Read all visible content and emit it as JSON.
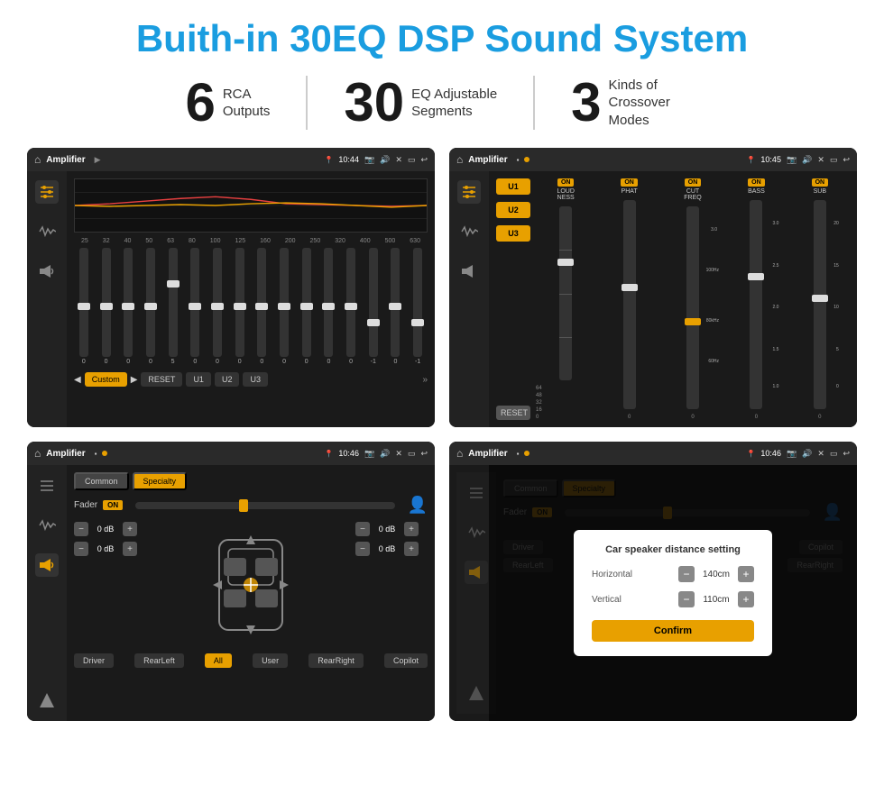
{
  "title": "Buith-in 30EQ DSP Sound System",
  "stats": [
    {
      "number": "6",
      "desc": "RCA\nOutputs"
    },
    {
      "number": "30",
      "desc": "EQ Adjustable\nSegments"
    },
    {
      "number": "3",
      "desc": "Kinds of\nCrossover Modes"
    }
  ],
  "screens": [
    {
      "id": "screen1",
      "statusBar": {
        "title": "Amplifier",
        "time": "10:44"
      },
      "type": "eq"
    },
    {
      "id": "screen2",
      "statusBar": {
        "title": "Amplifier",
        "time": "10:45"
      },
      "type": "crossover"
    },
    {
      "id": "screen3",
      "statusBar": {
        "title": "Amplifier",
        "time": "10:46"
      },
      "type": "fader"
    },
    {
      "id": "screen4",
      "statusBar": {
        "title": "Amplifier",
        "time": "10:46"
      },
      "type": "fader-dialog"
    }
  ],
  "eq": {
    "frequencies": [
      "25",
      "32",
      "40",
      "50",
      "63",
      "80",
      "100",
      "125",
      "160",
      "200",
      "250",
      "320",
      "400",
      "500",
      "630"
    ],
    "values": [
      "0",
      "0",
      "0",
      "0",
      "5",
      "0",
      "0",
      "0",
      "0",
      "0",
      "0",
      "0",
      "0",
      "-1",
      "0",
      "-1"
    ],
    "sliderPositions": [
      50,
      50,
      50,
      50,
      30,
      50,
      50,
      50,
      50,
      50,
      50,
      50,
      50,
      65,
      50,
      65
    ],
    "modeButtons": [
      "Custom",
      "RESET",
      "U1",
      "U2",
      "U3"
    ]
  },
  "crossover": {
    "uButtons": [
      "U1",
      "U2",
      "U3"
    ],
    "channels": [
      {
        "label": "LOUDNESS",
        "on": true
      },
      {
        "label": "PHAT",
        "on": true
      },
      {
        "label": "CUT FREQ",
        "on": true
      },
      {
        "label": "BASS",
        "on": true
      },
      {
        "label": "SUB",
        "on": true
      }
    ]
  },
  "fader": {
    "tabs": [
      "Common",
      "Specialty"
    ],
    "activeTab": "Specialty",
    "faderLabel": "Fader",
    "onBadge": "ON",
    "zones": [
      {
        "label": "— 0 dB +",
        "value": "0 dB"
      },
      {
        "label": "— 0 dB +",
        "value": "0 dB"
      },
      {
        "label": "— 0 dB +",
        "value": "0 dB"
      },
      {
        "label": "— 0 dB +",
        "value": "0 dB"
      }
    ],
    "bottomButtons": [
      "Driver",
      "RearLeft",
      "All",
      "User",
      "RearRight",
      "Copilot"
    ]
  },
  "dialog": {
    "title": "Car speaker distance setting",
    "fields": [
      {
        "label": "Horizontal",
        "value": "140cm"
      },
      {
        "label": "Vertical",
        "value": "110cm"
      }
    ],
    "confirmButton": "Confirm"
  }
}
